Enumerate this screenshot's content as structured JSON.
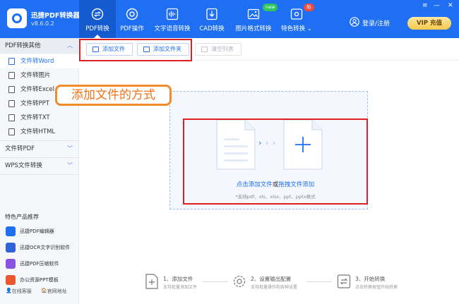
{
  "app": {
    "name": "迅捷PDF转换器",
    "version": "v8.6.0.2"
  },
  "nav": {
    "tabs": [
      {
        "label": "PDF转换",
        "icon": "swap-icon",
        "active": true
      },
      {
        "label": "PDF操作",
        "icon": "gear-icon"
      },
      {
        "label": "文字语音转换",
        "icon": "audio-wave-icon"
      },
      {
        "label": "CAD转换",
        "icon": "cad-download-icon"
      },
      {
        "label": "图片格式转换",
        "icon": "image-icon",
        "badge": "new"
      },
      {
        "label": "特色转换",
        "icon": "special-icon",
        "badge": "热"
      }
    ],
    "login": "登录/注册",
    "vip": "VIP 充值"
  },
  "sidebar": {
    "sections": [
      {
        "label": "PDF转换其他",
        "expanded": true
      },
      {
        "label": "文件转PDF"
      },
      {
        "label": "WPS文件转换"
      }
    ],
    "items": [
      {
        "label": "文件转Word",
        "active": true
      },
      {
        "label": "文件转图片"
      },
      {
        "label": "文件转Excel"
      },
      {
        "label": "文件转PPT"
      },
      {
        "label": "文件转TXT"
      },
      {
        "label": "文件转HTML"
      }
    ],
    "products_title": "特色产品推荐",
    "products": [
      {
        "label": "迅捷PDF编辑器",
        "color": "#1f6ff2"
      },
      {
        "label": "迅捷OCR文字识别软件",
        "color": "#2f63d6"
      },
      {
        "label": "迅捷PDF压缩软件",
        "color": "#8a52e0"
      },
      {
        "label": "办公资源PPT模板",
        "color": "#e8572e"
      }
    ],
    "bottom": {
      "service": "在线客服",
      "website": "官网地址"
    }
  },
  "toolbar": {
    "add_file": "添加文件",
    "add_folder": "添加文件夹",
    "clear_list": "清空列表"
  },
  "annotation": "添加文件的方式",
  "dropzone": {
    "click_add": "点击添加文件",
    "or": "或",
    "drag_add": "拖拽文件添加",
    "supported": "*支持pdf、xls、xlsx、ppt、pptx格式"
  },
  "steps": [
    {
      "title": "1、添加文件",
      "sub": "支持批量添加文件"
    },
    {
      "title": "2、设置输出配置",
      "sub": "支持批量操作和各种设置"
    },
    {
      "title": "3、开始转换",
      "sub": "点击转换按钮开始转换"
    }
  ]
}
